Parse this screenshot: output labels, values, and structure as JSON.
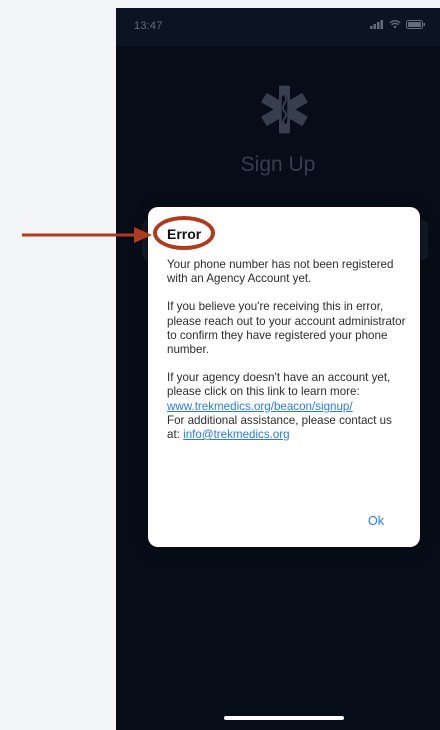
{
  "status_bar": {
    "time": "13:47"
  },
  "app": {
    "title": "Sign Up"
  },
  "alert": {
    "title": "Error",
    "para1": "Your phone number has not been registered with an Agency Account yet.",
    "para2": "If you believe you're receiving this in error, please reach out to your account administrator to confirm they have registered your phone number.",
    "para3_text": "If your agency doesn't have an account yet, please click on this link to learn more: ",
    "para3_link": "www.trekmedics.org/beacon/signup/",
    "para4_text": "For additional assistance, please contact us at: ",
    "para4_link": "info@trekmedics.org",
    "ok_label": "Ok"
  },
  "colors": {
    "annotation": "#b03a1e",
    "link": "#2a7be4",
    "app_background": "#0a1220"
  },
  "icons": {
    "logo": "star-of-life-icon",
    "signal": "signal-icon",
    "wifi": "wifi-icon",
    "battery": "battery-icon",
    "location": "location-arrow-icon"
  }
}
